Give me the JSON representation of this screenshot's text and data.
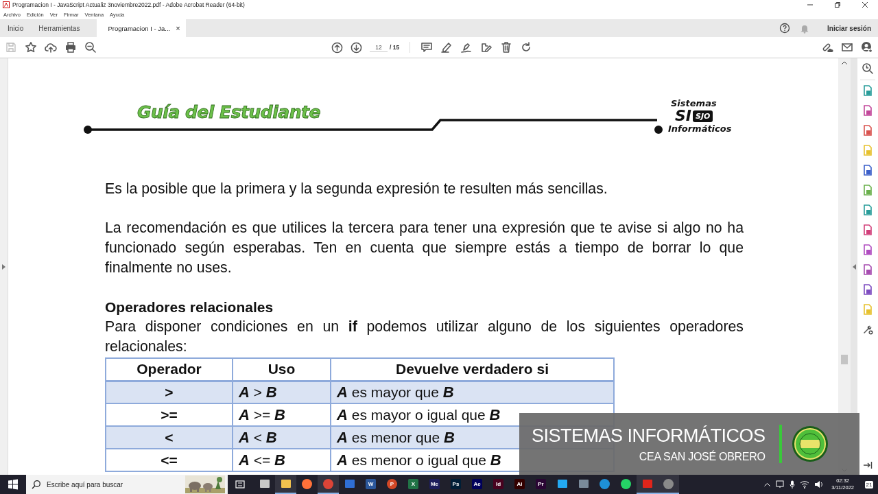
{
  "window": {
    "title": "Programacion I - JavaScript Actualiz 3noviembre2022.pdf - Adobe Acrobat Reader (64-bit)"
  },
  "menu": [
    "Archivo",
    "Edición",
    "Ver",
    "Firmar",
    "Ventana",
    "Ayuda"
  ],
  "tabs": [
    {
      "label": "Inicio",
      "selected": false
    },
    {
      "label": "Herramientas",
      "selected": false
    },
    {
      "label": "Programacion I - Ja...",
      "selected": true
    }
  ],
  "close_tab": "×",
  "account": {
    "label": "Iniciar sesión"
  },
  "toolbar": {
    "page": "12",
    "total": "/ 15"
  },
  "tools": [
    {
      "color": "#2a9d9a"
    },
    {
      "color": "#c2479a"
    },
    {
      "color": "#d9534f"
    },
    {
      "color": "#e6c12e"
    },
    {
      "color": "#3b5fc9"
    },
    {
      "color": "#6ab04c"
    },
    {
      "color": "#2a9d9a"
    },
    {
      "color": "#d13f7a"
    },
    {
      "color": "#b04cc0"
    },
    {
      "color": "#a64cb0"
    },
    {
      "color": "#7d4cc0"
    },
    {
      "color": "#e6c12e"
    }
  ],
  "document": {
    "header_title": "Guía del Estudiante",
    "logo": {
      "top": "Sistemas",
      "mark": "SI",
      "badge": "SJO",
      "bottom": "Informáticos"
    },
    "paragraphs": [
      "Es la posible que la primera y la segunda expresión te resulten más sencillas.",
      "La recomendación es que utilices la tercera para tener una expresión que te avise si algo no ha funcionado según esperabas. Ten en cuenta que siempre estás a tiempo de borrar lo que finalmente no uses."
    ],
    "heading": "Operadores relacionales",
    "intro": "Para disponer condiciones en un **if** podemos utilizar alguno de los siguientes operadores relacionales:",
    "table": {
      "columns": [
        "Operador",
        "Uso",
        "Devuelve verdadero si"
      ],
      "rows": [
        {
          "operator": ">",
          "usage": "**A** > **B**",
          "result": "**A** es mayor que **B**"
        },
        {
          "operator": ">=",
          "usage": "**A** >= **B**",
          "result": "**A** es mayor o igual que **B**"
        },
        {
          "operator": "<",
          "usage": "**A** < **B**",
          "result": "**A** es menor que **B**"
        },
        {
          "operator": "<=",
          "usage": "**A** <= **B**",
          "result": "**A** es menor o igual que **B**"
        }
      ]
    }
  },
  "overlay": {
    "title": "SISTEMAS INFORMÁTICOS",
    "subtitle": "CEA SAN JOSÉ OBRERO"
  },
  "taskbar": {
    "search_placeholder": "Escribe aquí para buscar",
    "apps": [
      {
        "kind": "glyph",
        "color": "#c8c8c8",
        "running": false
      },
      {
        "kind": "glyph",
        "color": "#f2c14e",
        "running": true
      },
      {
        "kind": "round",
        "color": "#ff7139",
        "running": false
      },
      {
        "kind": "round",
        "color": "#db4437",
        "running": true
      },
      {
        "kind": "glyph",
        "color": "#2f6fd6",
        "running": false
      },
      {
        "kind": "tile",
        "label": "W",
        "color": "#2b579a",
        "running": false
      },
      {
        "kind": "round",
        "label": "P",
        "color": "#d24726",
        "running": false
      },
      {
        "kind": "tile",
        "label": "X",
        "color": "#217346",
        "running": false
      },
      {
        "kind": "tile",
        "label": "Me",
        "color": "#1d1d5c",
        "running": false
      },
      {
        "kind": "tile",
        "label": "Ps",
        "color": "#001e36",
        "running": false
      },
      {
        "kind": "tile",
        "label": "Ae",
        "color": "#00005b",
        "running": false
      },
      {
        "kind": "tile",
        "label": "Id",
        "color": "#49021f",
        "running": false
      },
      {
        "kind": "tile",
        "label": "Ai",
        "color": "#330000",
        "running": false
      },
      {
        "kind": "tile",
        "label": "Pr",
        "color": "#2a0634",
        "running": false
      },
      {
        "kind": "glyph",
        "color": "#23a9f2",
        "running": false
      },
      {
        "kind": "glyph",
        "color": "#7a8a9a",
        "running": false
      },
      {
        "kind": "round",
        "color": "#1e90d6",
        "running": false
      },
      {
        "kind": "round",
        "color": "#25d366",
        "running": false
      },
      {
        "kind": "glyph",
        "color": "#e1251b",
        "running": true
      },
      {
        "kind": "round",
        "color": "#8a8a8a",
        "running": true
      }
    ],
    "time": "02:32",
    "date": "3/11/2022",
    "notifications": "21"
  }
}
